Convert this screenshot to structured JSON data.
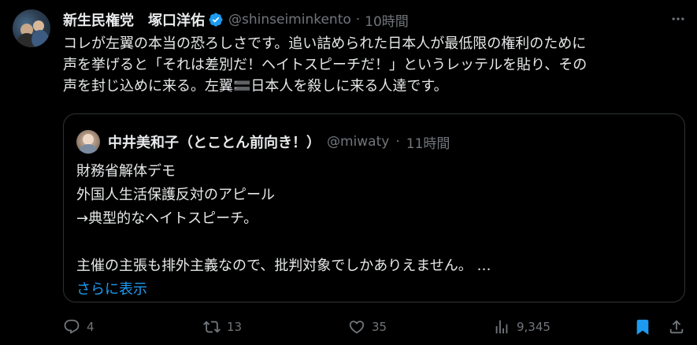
{
  "tweet": {
    "author_name": "新生民権党　塚口洋佑",
    "handle": "@shinseiminkento",
    "separator": "·",
    "time": "10時間",
    "lines": [
      "コレが左翼の本当の恐ろしさです。追い詰められた日本人が最低限の権利のために",
      "声を挙げると「それは差別だ！ヘイトスピーチだ！」というレッテルを貼り、その",
      "声を封じ込めに来る。左翼🟰日本人を殺しに来る人達です。"
    ]
  },
  "quote": {
    "author_name": "中井美和子（とことん前向き！）",
    "handle": "@miwaty",
    "separator": "·",
    "time": "11時間",
    "lines": [
      "財務省解体デモ",
      "外国人生活保護反対のアピール",
      "→典型的なヘイトスピーチ。",
      "",
      "主催の主張も排外主義なので、批判対象でしかありえません。 …"
    ],
    "show_more": "さらに表示"
  },
  "actions": {
    "replies": "4",
    "reposts": "13",
    "likes": "35",
    "views": "9,345"
  },
  "colors": {
    "background": "#000000",
    "text": "#e7e9ea",
    "muted": "#71767b",
    "accent": "#1d9bf0",
    "border": "#2f3336"
  },
  "icons": [
    "verified-badge-icon",
    "more-icon",
    "reply-icon",
    "repost-icon",
    "like-icon",
    "views-icon",
    "bookmark-icon",
    "share-icon"
  ]
}
